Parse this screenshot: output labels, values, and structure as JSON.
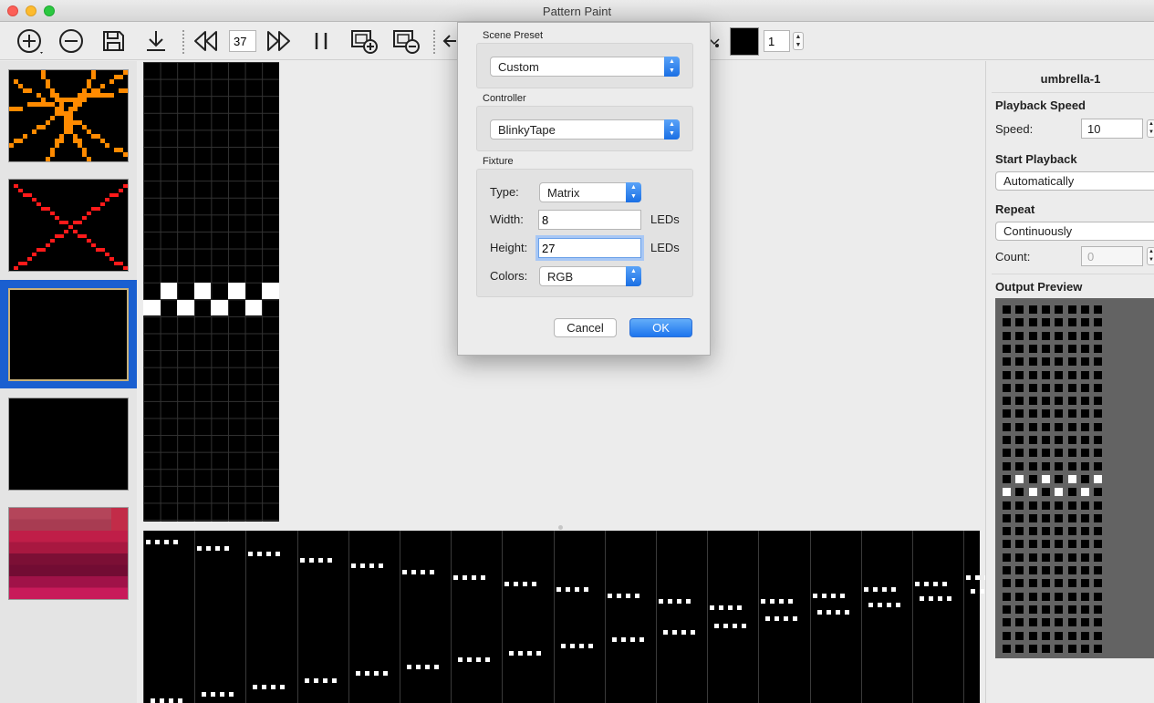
{
  "window": {
    "title": "Pattern Paint",
    "traffic_lights": {
      "close": "#fc5f57",
      "minimize": "#fdbb2e",
      "zoom": "#2bc840"
    }
  },
  "toolbar": {
    "icons": [
      "add-pattern-icon",
      "remove-pattern-icon",
      "save-icon",
      "export-icon",
      "step-back-icon",
      "step-forward-icon",
      "pause-icon",
      "add-frame-icon",
      "delete-frame-icon",
      "undo-icon"
    ],
    "frame_number": "37",
    "brush_color": "#000000",
    "brush_size": "1"
  },
  "sidebar": {
    "patterns": [
      {
        "name": "orange-x-pattern",
        "color": "#ff8a00"
      },
      {
        "name": "red-x-pattern",
        "color": "#ff1a1a"
      },
      {
        "name": "black-pattern",
        "selected": true
      },
      {
        "name": "black-pattern-2"
      },
      {
        "name": "pink-gradient-pattern"
      }
    ]
  },
  "dialog": {
    "scene_preset_label": "Scene Preset",
    "scene_preset_value": "Custom",
    "controller_label": "Controller",
    "controller_value": "BlinkyTape",
    "fixture_label": "Fixture",
    "type_label": "Type:",
    "type_value": "Matrix",
    "width_label": "Width:",
    "width_value": "8",
    "height_label": "Height:",
    "height_value": "27",
    "units": "LEDs",
    "colors_label": "Colors:",
    "colors_value": "RGB",
    "cancel_label": "Cancel",
    "ok_label": "OK"
  },
  "right_panel": {
    "pattern_name": "umbrella-1",
    "playback_speed_heading": "Playback Speed",
    "speed_label": "Speed:",
    "speed_value": "10",
    "start_playback_heading": "Start Playback",
    "start_playback_value": "Automatically",
    "repeat_heading": "Repeat",
    "repeat_value": "Continuously",
    "count_label": "Count:",
    "count_value": "0",
    "output_preview_heading": "Output Preview"
  }
}
